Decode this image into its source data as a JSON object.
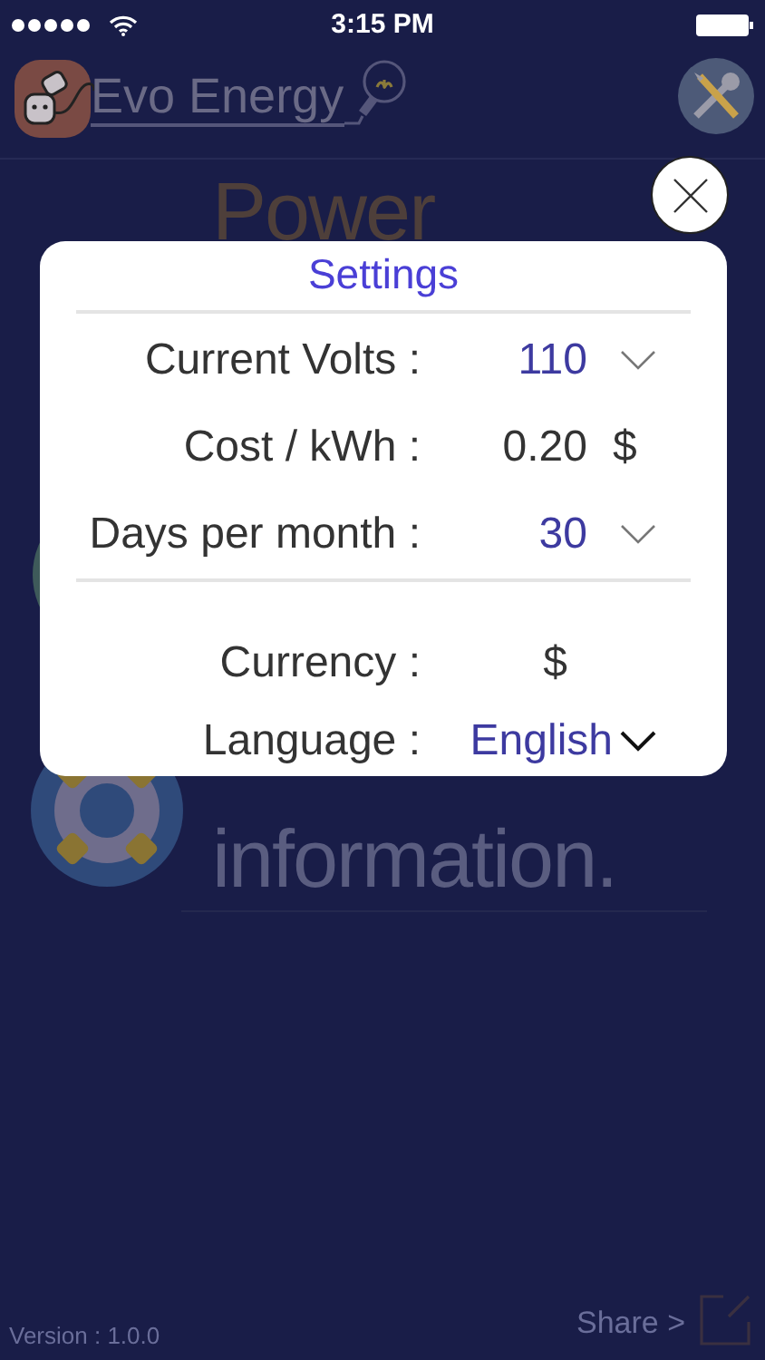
{
  "status_bar": {
    "time": "3:15 PM"
  },
  "header": {
    "app_name": "Evo Energy"
  },
  "menu": [
    {
      "lines": [
        "Power"
      ]
    },
    {
      "lines": [
        "information."
      ]
    }
  ],
  "settings": {
    "title": "Settings",
    "groups": [
      {
        "rows": [
          {
            "kind": "picker",
            "label": "Current Volts :",
            "value": "110"
          },
          {
            "kind": "amount",
            "label": "Cost / kWh :",
            "value": "0.20",
            "unit": "$"
          },
          {
            "kind": "picker",
            "label": "Days per month :",
            "value": "30"
          }
        ]
      },
      {
        "rows": [
          {
            "kind": "static",
            "label": "Currency :",
            "value": "$"
          },
          {
            "kind": "dropdown",
            "label": "Language :",
            "value": "English"
          }
        ]
      }
    ]
  },
  "footer": {
    "version": "Version : 1.0.0",
    "share": "Share >"
  }
}
